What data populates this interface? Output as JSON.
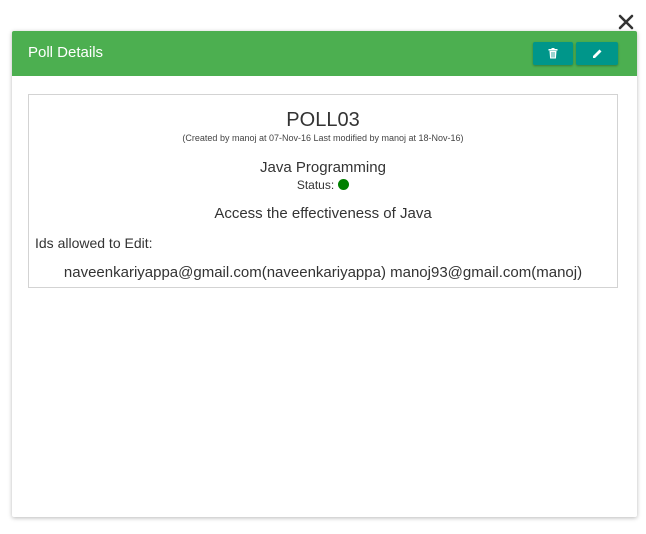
{
  "modal": {
    "title": "Poll Details",
    "header_color": "#4caf50",
    "button_color": "#00968a",
    "delete_icon": "trash-icon",
    "edit_icon": "pencil-icon",
    "close_icon": "close-icon"
  },
  "poll": {
    "id": "POLL03",
    "meta": "(Created by manoj at 07-Nov-16 Last modified by manoj at 18-Nov-16)",
    "name": "Java Programming",
    "status_label": "Status:",
    "status_color": "#008000",
    "description": "Access the effectiveness of Java",
    "ids_label": "Ids allowed to Edit:",
    "ids_allowed": "naveenkariyappa@gmail.com(naveenkariyappa) manoj93@gmail.com(manoj)"
  }
}
